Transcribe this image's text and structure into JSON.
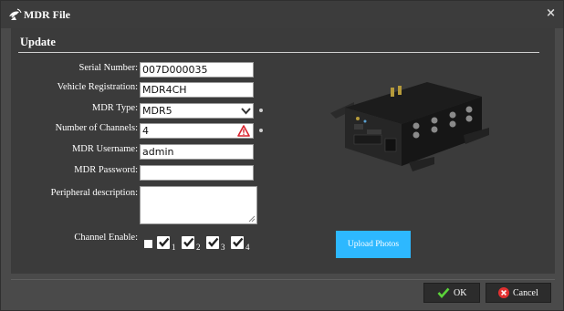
{
  "window": {
    "title": "MDR File",
    "close_glyph": "×"
  },
  "section": {
    "title": "Update"
  },
  "form": {
    "serial_number": {
      "label": "Serial Number:",
      "value": "007D000035"
    },
    "vehicle_registration": {
      "label": "Vehicle Registration:",
      "value": "MDR4CH"
    },
    "mdr_type": {
      "label": "MDR Type:",
      "value": "MDR5"
    },
    "channels": {
      "label": "Number of Channels:",
      "value": "4"
    },
    "username": {
      "label": "MDR Username:",
      "value": "admin"
    },
    "password": {
      "label": "MDR Password:",
      "value": ""
    },
    "peripheral": {
      "label": "Peripheral description:",
      "value": ""
    },
    "channel_enable": {
      "label": "Channel Enable:",
      "channels": [
        {
          "num": "1",
          "checked": true
        },
        {
          "num": "2",
          "checked": true
        },
        {
          "num": "3",
          "checked": true
        },
        {
          "num": "4",
          "checked": true
        }
      ]
    }
  },
  "upload": {
    "label": "Upload Photos"
  },
  "footer": {
    "ok_label": "OK",
    "cancel_label": "Cancel"
  },
  "icons": {
    "title": "satellite-dish-icon",
    "dropdown": "chevron-down-icon",
    "warning": "warning-icon",
    "ok": "checkmark-icon",
    "cancel": "cancel-icon"
  },
  "colors": {
    "dialog_bg": "#4a4a4a",
    "panel_bg": "#3b3b3b",
    "accent": "#2db8ff",
    "ok_check": "#5bd33a",
    "cancel_red": "#e23030",
    "warning_red": "#d9232e"
  }
}
